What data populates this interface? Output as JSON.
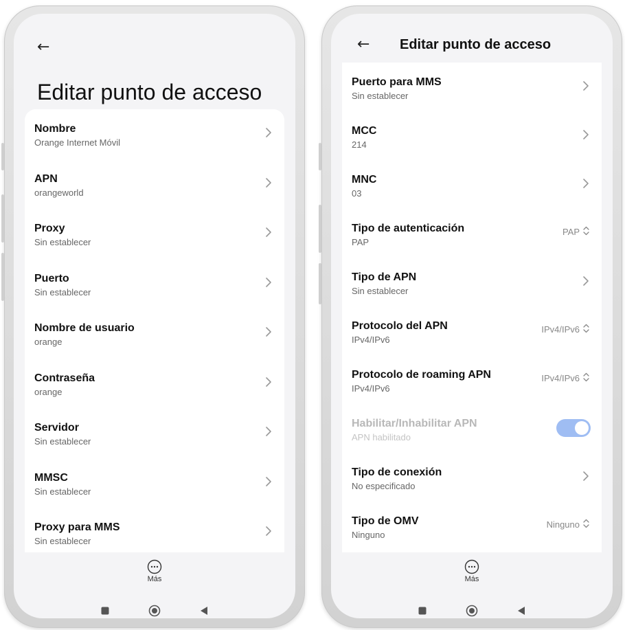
{
  "left_screen": {
    "back_glyph": "←",
    "title": "Editar punto de acceso",
    "items": [
      {
        "title": "Nombre",
        "value": "Orange Internet Móvil"
      },
      {
        "title": "APN",
        "value": "orangeworld"
      },
      {
        "title": "Proxy",
        "value": "Sin establecer"
      },
      {
        "title": "Puerto",
        "value": "Sin establecer"
      },
      {
        "title": "Nombre de usuario",
        "value": "orange"
      },
      {
        "title": "Contraseña",
        "value": "orange"
      },
      {
        "title": "Servidor",
        "value": "Sin establecer"
      },
      {
        "title": "MMSC",
        "value": "Sin establecer"
      },
      {
        "title": "Proxy para MMS",
        "value": "Sin establecer"
      }
    ],
    "more_label": "Más"
  },
  "right_screen": {
    "back_glyph": "←",
    "title": "Editar punto de acceso",
    "items": [
      {
        "title": "Puerto para MMS",
        "value": "Sin establecer"
      },
      {
        "title": "MCC",
        "value": "214"
      },
      {
        "title": "MNC",
        "value": "03"
      },
      {
        "title": "Tipo de autenticación",
        "value": "PAP",
        "selector": "PAP"
      },
      {
        "title": "Tipo de APN",
        "value": "Sin establecer"
      },
      {
        "title": "Protocolo del APN",
        "value": "IPv4/IPv6",
        "selector": "IPv4/IPv6"
      },
      {
        "title": "Protocolo de roaming APN",
        "value": "IPv4/IPv6",
        "selector": "IPv4/IPv6"
      },
      {
        "title": "Habilitar/Inhabilitar APN",
        "value": "APN habilitado",
        "toggle_on": true,
        "disabled": true
      },
      {
        "title": "Tipo de conexión",
        "value": "No especificado"
      },
      {
        "title": "Tipo de OMV",
        "value": "Ninguno",
        "selector": "Ninguno"
      }
    ],
    "more_label": "Más"
  },
  "icons": {
    "back": "arrow-left-icon",
    "chevron": "chevron-right-icon",
    "selector": "up-down-chevron-icon",
    "more": "more-dots-icon",
    "nav_recents": "square-icon",
    "nav_home": "circle-icon",
    "nav_back": "triangle-left-icon"
  },
  "colors": {
    "screen_bg": "#f4f4f6",
    "card_bg": "#ffffff",
    "toggle_on": "#9fbdf3",
    "text_primary": "#111111",
    "text_secondary": "#666666"
  }
}
